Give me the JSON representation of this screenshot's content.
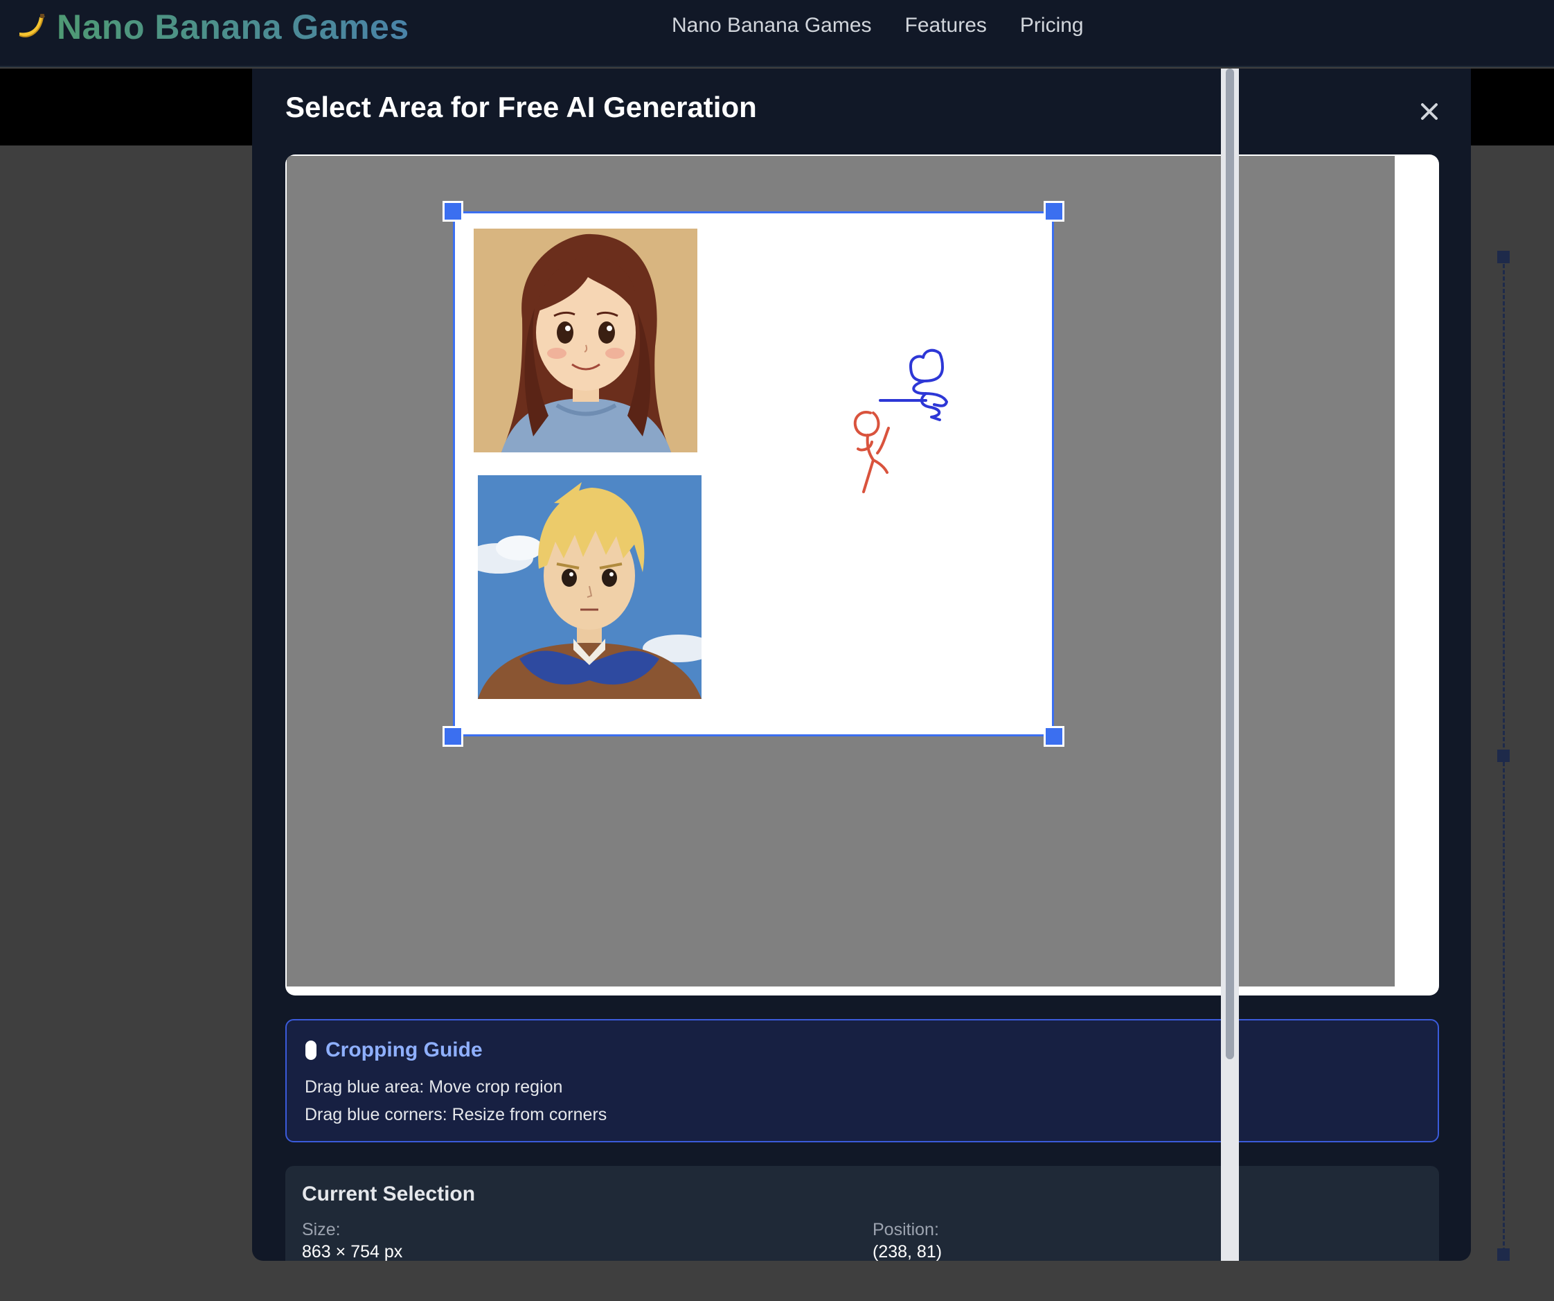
{
  "header": {
    "brand_title": "Nano Banana Games",
    "brand_icon": "banana-icon",
    "nav": [
      {
        "label": "Nano Banana Games"
      },
      {
        "label": "Features"
      },
      {
        "label": "Pricing"
      }
    ]
  },
  "modal": {
    "title": "Select Area for Free AI Generation",
    "close_icon": "close-icon",
    "canvas": {
      "portraits": [
        {
          "name": "girl-portrait",
          "description": "anime girl with long brown hair"
        },
        {
          "name": "boy-portrait",
          "description": "anime boy with blond hair and blue scarf"
        }
      ],
      "doodles": [
        "blue-stick-figure",
        "red-stick-figure"
      ]
    },
    "guide": {
      "icon": "mouse-icon",
      "title": "Cropping Guide",
      "lines": [
        "Drag blue area: Move crop region",
        "Drag blue corners: Resize from corners"
      ]
    },
    "selection": {
      "title": "Current Selection",
      "size_label": "Size:",
      "size_value": "863 × 754 px",
      "position_label": "Position:",
      "position_value": "(238, 81)"
    }
  },
  "colors": {
    "accent": "#3b6ff0",
    "nav_bg": "#111827",
    "brand_green": "#4f9a74",
    "guide_bg": "#172042",
    "guide_title": "#8fb0ff"
  }
}
